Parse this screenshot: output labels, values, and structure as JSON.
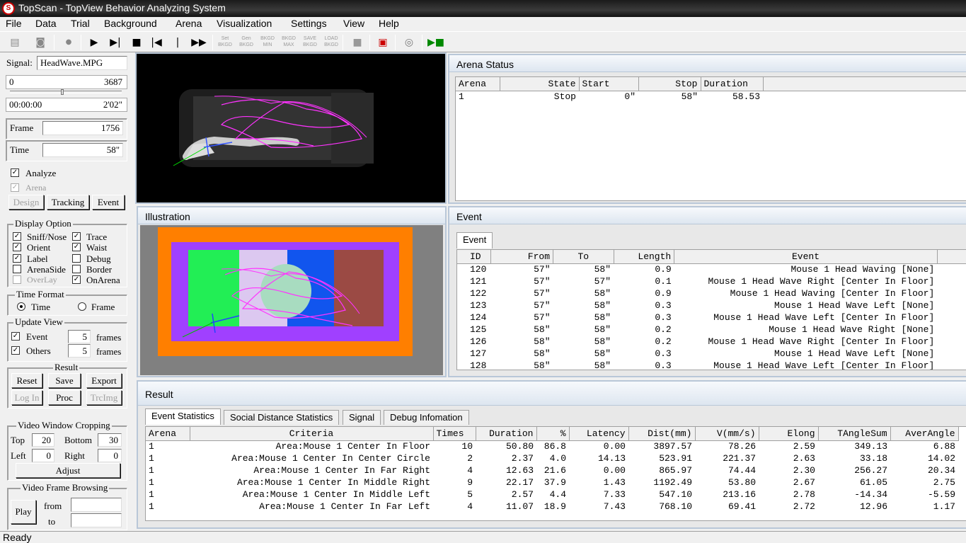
{
  "window": {
    "title": "TopScan - TopView Behavior Analyzing System"
  },
  "menu": [
    "File",
    "Data",
    "Trial",
    "Background",
    "Arena",
    "Visualization",
    "Settings",
    "View",
    "Help"
  ],
  "toolbar": {
    "set": "Set",
    "bkgd": "BKGD",
    "gen": "Gen",
    "bkgd2": "BKGD",
    "bkgd_min": "BKGD",
    "min": "MIN",
    "bkgd_max": "BKGD",
    "max": "MAX",
    "save": "SAVE",
    "save_bkgd": "BKGD",
    "load": "LOAD",
    "load_bkgd": "BKGD"
  },
  "left": {
    "signal_label": "Signal:",
    "signal_value": "HeadWave.MPG",
    "frame_min": "0",
    "frame_max": "3687",
    "time_min": "00:00:00",
    "time_max": "2'02\"",
    "frame_label": "Frame",
    "frame_value": "1756",
    "time_label": "Time",
    "time_value": "58\"",
    "analyze": "Analyze",
    "arena": "Arena",
    "design": "Design",
    "tracking": "Tracking",
    "event": "Event",
    "display_option": "Display Option",
    "opt": {
      "sniff": "Sniff/Nose",
      "trace": "Trace",
      "orient": "Orient",
      "waist": "Waist",
      "label": "Label",
      "debug": "Debug",
      "arenaside": "ArenaSide",
      "border": "Border",
      "overlay": "OverLay",
      "onarena": "OnArena"
    },
    "time_format": "Time Format",
    "tf_time": "Time",
    "tf_frame": "Frame",
    "update_view": "Update View",
    "uv_event": "Event",
    "uv_event_n": "5",
    "uv_others": "Others",
    "uv_others_n": "5",
    "frames": "frames",
    "result": "Result",
    "reset": "Reset",
    "save": "Save",
    "export": "Export",
    "login": "Log In",
    "proc": "Proc",
    "trcimg": "TrcImg",
    "crop": "Video Window Cropping",
    "top": "Top",
    "top_v": "20",
    "bottom": "Bottom",
    "bottom_v": "30",
    "left": "Left",
    "left_v": "0",
    "right": "Right",
    "right_v": "0",
    "adjust": "Adjust",
    "browse": "Video Frame Browsing",
    "play": "Play",
    "from": "from",
    "to": "to"
  },
  "illustration": {
    "title": "Illustration"
  },
  "arena_status": {
    "title": "Arena Status",
    "columns": [
      "Arena",
      "State",
      "Start",
      "Stop",
      "Duration"
    ],
    "rows": [
      [
        "1",
        "Stop",
        "0\"",
        "58\"",
        "58.53"
      ]
    ]
  },
  "event": {
    "title": "Event",
    "tab": "Event",
    "columns": [
      "ID",
      "From",
      "To",
      "Length",
      "Event"
    ],
    "rows": [
      [
        "120",
        "57\"",
        "58\"",
        "0.9",
        "Mouse 1 Head Waving [None]"
      ],
      [
        "121",
        "57\"",
        "57\"",
        "0.1",
        "Mouse 1 Head Wave Right [Center In Floor]"
      ],
      [
        "122",
        "57\"",
        "58\"",
        "0.9",
        "Mouse 1 Head Waving [Center In Floor]"
      ],
      [
        "123",
        "57\"",
        "58\"",
        "0.3",
        "Mouse 1 Head Wave Left [None]"
      ],
      [
        "124",
        "57\"",
        "58\"",
        "0.3",
        "Mouse 1 Head Wave Left [Center In Floor]"
      ],
      [
        "125",
        "58\"",
        "58\"",
        "0.2",
        "Mouse 1 Head Wave Right [None]"
      ],
      [
        "126",
        "58\"",
        "58\"",
        "0.2",
        "Mouse 1 Head Wave Right [Center In Floor]"
      ],
      [
        "127",
        "58\"",
        "58\"",
        "0.3",
        "Mouse 1 Head Wave Left [None]"
      ],
      [
        "128",
        "58\"",
        "58\"",
        "0.3",
        "Mouse 1 Head Wave Left [Center In Floor]"
      ]
    ]
  },
  "result": {
    "title": "Result",
    "tabs": [
      "Event Statistics",
      "Social Distance Statistics",
      "Signal",
      "Debug Infomation"
    ],
    "columns": [
      "Arena",
      "Criteria",
      "Times",
      "Duration",
      "%",
      "Latency",
      "Dist(mm)",
      "V(mm/s)",
      "Elong",
      "TAngleSum",
      "AverAngle"
    ],
    "rows": [
      [
        "1",
        "Area:Mouse 1 Center In Floor",
        "10",
        "50.80",
        "86.8",
        "0.00",
        "3897.57",
        "78.26",
        "2.59",
        "349.13",
        "6.88"
      ],
      [
        "1",
        "Area:Mouse 1 Center In Center Circle",
        "2",
        "2.37",
        "4.0",
        "14.13",
        "523.91",
        "221.37",
        "2.63",
        "33.18",
        "14.02"
      ],
      [
        "1",
        "Area:Mouse 1 Center In Far Right",
        "4",
        "12.63",
        "21.6",
        "0.00",
        "865.97",
        "74.44",
        "2.30",
        "256.27",
        "20.34"
      ],
      [
        "1",
        "Area:Mouse 1 Center In Middle Right",
        "9",
        "22.17",
        "37.9",
        "1.43",
        "1192.49",
        "53.80",
        "2.67",
        "61.05",
        "2.75"
      ],
      [
        "1",
        "Area:Mouse 1 Center In Middle Left",
        "5",
        "2.57",
        "4.4",
        "7.33",
        "547.10",
        "213.16",
        "2.78",
        "-14.34",
        "-5.59"
      ],
      [
        "1",
        "Area:Mouse 1 Center In Far Left",
        "4",
        "11.07",
        "18.9",
        "7.43",
        "768.10",
        "69.41",
        "2.72",
        "12.96",
        "1.17"
      ]
    ]
  },
  "status": "Ready"
}
